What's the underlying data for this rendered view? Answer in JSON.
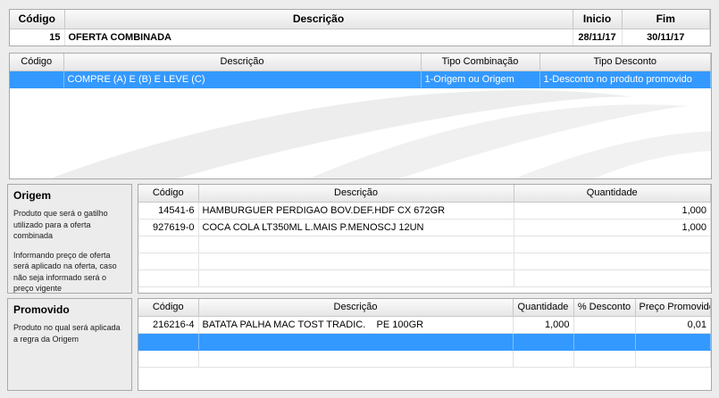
{
  "header": {
    "columns": {
      "codigo": "Código",
      "descricao": "Descrição",
      "inicio": "Inicio",
      "fim": "Fim"
    },
    "row": {
      "codigo": "15",
      "descricao": "OFERTA COMBINADA",
      "inicio": "28/11/17",
      "fim": "30/11/17"
    }
  },
  "combinations": {
    "columns": {
      "codigo": "Código",
      "descricao": "Descrição",
      "tipo_combinacao": "Tipo Combinação",
      "tipo_desconto": "Tipo Desconto"
    },
    "rows": [
      {
        "codigo": "",
        "descricao": "COMPRE (A) E (B) E LEVE (C)",
        "tipo_combinacao": "1-Origem ou Origem",
        "tipo_desconto": "1-Desconto no produto promovido"
      }
    ]
  },
  "origem": {
    "title": "Origem",
    "help1": "Produto que será o gatilho utilizado para a oferta combinada",
    "help2": "Informando preço de oferta será aplicado na oferta, caso não seja informado será o preço vigente",
    "columns": {
      "codigo": "Código",
      "descricao": "Descrição",
      "quantidade": "Quantidade"
    },
    "rows": [
      {
        "codigo": "14541-6",
        "descricao": "HAMBURGUER PERDIGAO BOV.DEF.HDF CX 672GR",
        "quantidade": "1,000"
      },
      {
        "codigo": "927619-0",
        "descricao": "COCA COLA LT350ML L.MAIS P.MENOSCJ  12UN",
        "quantidade": "1,000"
      }
    ]
  },
  "promovido": {
    "title": "Promovido",
    "help1": "Produto no qual será aplicada a regra da Origem",
    "columns": {
      "codigo": "Código",
      "descricao": "Descrição",
      "quantidade": "Quantidade",
      "desconto": "% Desconto",
      "preco": "Preço Promovido"
    },
    "rows": [
      {
        "codigo": "216216-4",
        "descricao": "BATATA PALHA MAC TOST TRADIC.    PE 100GR",
        "quantidade": "1,000",
        "desconto": "",
        "preco": "0,01"
      }
    ]
  },
  "colors": {
    "selection": "#3399ff",
    "panel_bg": "#ececec",
    "border": "#a9a9a9"
  }
}
